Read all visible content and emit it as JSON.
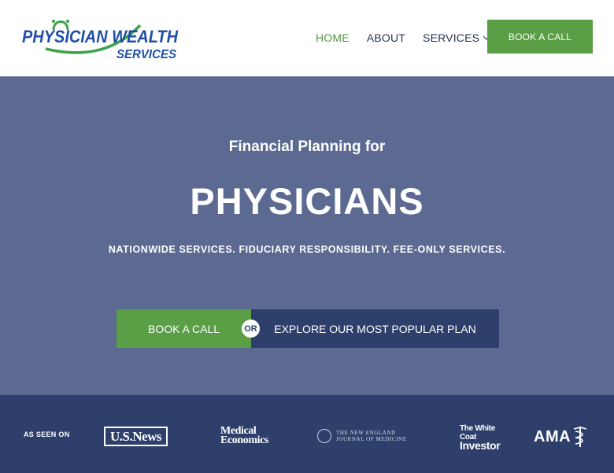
{
  "logo": {
    "line1": "PHYSICIAN WEALTH",
    "line2": "SERVICES",
    "colors": {
      "blue": "#1f4fa8",
      "green": "#3ea24a"
    }
  },
  "nav": {
    "items": [
      {
        "label": "HOME",
        "active": true
      },
      {
        "label": "ABOUT",
        "active": false
      },
      {
        "label": "SERVICES",
        "active": false,
        "has_dropdown": true
      }
    ],
    "cta_label": "BOOK A CALL"
  },
  "hero": {
    "kicker": "Financial Planning for",
    "title": "PHYSICIANS",
    "tagline": "NATIONWIDE SERVICES. FIDUCIARY RESPONSIBILITY. FEE-ONLY SERVICES.",
    "book_label": "BOOK A CALL",
    "or_label": "OR",
    "explore_label": "EXPLORE OUR MOST POPULAR PLAN",
    "background_color": "#5c6a92"
  },
  "press": {
    "label": "AS SEEN ON",
    "logos": {
      "usnews": "U.S.News",
      "medecon_line1": "Medical",
      "medecon_line2": "Economics",
      "nejm_line1": "The NEW ENGLAND",
      "nejm_line2": "JOURNAL of MEDICINE",
      "wci_line1": "The White Coat",
      "wci_line2": "Investor",
      "ama": "AMA"
    },
    "background_color": "#2e3f6b"
  },
  "colors": {
    "accent_green": "#5a9e45",
    "navy": "#2e3f6b",
    "text_dark": "#2a3450"
  }
}
